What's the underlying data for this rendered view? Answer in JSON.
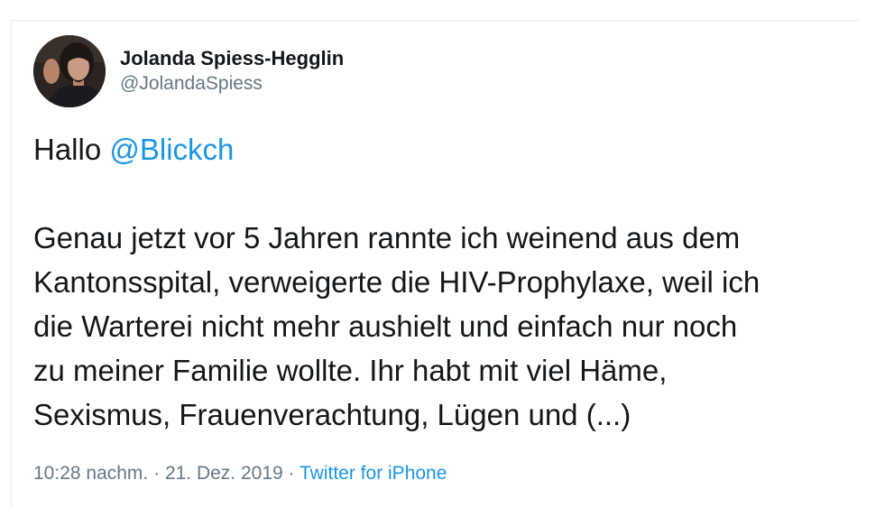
{
  "author": {
    "display_name": "Jolanda Spiess-Hegglin",
    "handle": "@JolandaSpiess"
  },
  "tweet": {
    "greeting": "Hallo",
    "mention": "@Blickch",
    "lines": [
      "Genau jetzt vor 5 Jahren rannte ich weinend aus dem",
      "Kantonsspital, verweigerte die HIV-Prophylaxe, weil ich",
      "die Warterei nicht mehr aushielt und einfach nur noch",
      "zu meiner Familie wollte. Ihr habt mit viel Häme,",
      "Sexismus, Frauenverachtung, Lügen und (...)"
    ]
  },
  "meta": {
    "time": "10:28 nachm.",
    "separator1": " · ",
    "date": "21. Dez. 2019",
    "separator2": " · ",
    "source": "Twitter for iPhone"
  },
  "colors": {
    "link": "#1b95e0",
    "text": "#14171a",
    "muted": "#657786"
  }
}
